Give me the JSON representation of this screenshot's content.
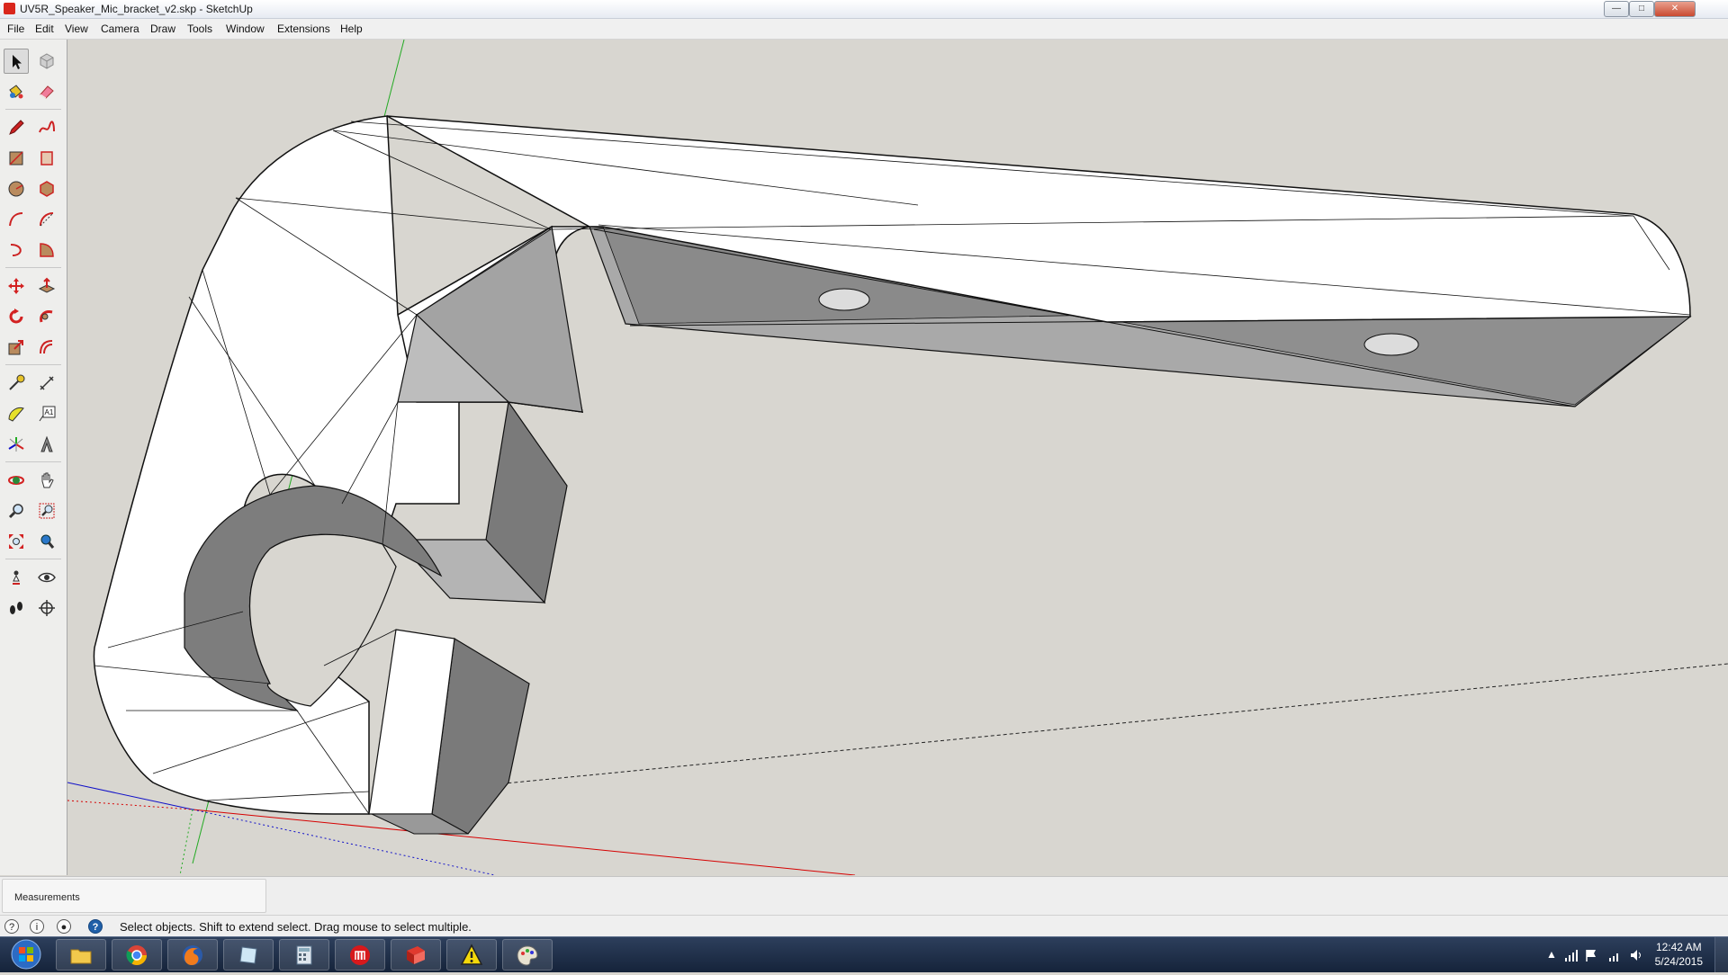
{
  "window": {
    "title": "UV5R_Speaker_Mic_bracket_v2.skp - SketchUp",
    "minimize_label": "—",
    "maximize_label": "□",
    "close_label": "✕"
  },
  "menu": {
    "items": [
      {
        "label": "File"
      },
      {
        "label": "Edit"
      },
      {
        "label": "View"
      },
      {
        "label": "Camera"
      },
      {
        "label": "Draw"
      },
      {
        "label": "Tools"
      },
      {
        "label": "Window"
      },
      {
        "label": "Extensions"
      },
      {
        "label": "Help"
      }
    ]
  },
  "toolbar": {
    "tools": [
      {
        "name": "select-tool",
        "icon": "arrow-icon",
        "active": true
      },
      {
        "name": "component-tool",
        "icon": "component-icon"
      },
      {
        "name": "paint-bucket-tool",
        "icon": "paint-bucket-icon"
      },
      {
        "name": "eraser-tool",
        "icon": "eraser-icon"
      },
      {
        "name": "line-tool",
        "icon": "pencil-icon"
      },
      {
        "name": "freehand-tool",
        "icon": "freehand-icon"
      },
      {
        "name": "rectangle-tool",
        "icon": "rectangle-icon"
      },
      {
        "name": "rotated-rectangle-tool",
        "icon": "rotated-rectangle-icon"
      },
      {
        "name": "circle-tool",
        "icon": "circle-icon"
      },
      {
        "name": "polygon-tool",
        "icon": "polygon-icon"
      },
      {
        "name": "arc-tool",
        "icon": "arc-icon"
      },
      {
        "name": "two-point-arc-tool",
        "icon": "two-point-arc-icon"
      },
      {
        "name": "three-point-arc-tool",
        "icon": "three-point-arc-icon"
      },
      {
        "name": "pie-tool",
        "icon": "pie-icon"
      },
      {
        "name": "move-tool",
        "icon": "move-icon"
      },
      {
        "name": "push-pull-tool",
        "icon": "push-pull-icon"
      },
      {
        "name": "rotate-tool",
        "icon": "rotate-icon"
      },
      {
        "name": "follow-me-tool",
        "icon": "follow-me-icon"
      },
      {
        "name": "scale-tool",
        "icon": "scale-icon"
      },
      {
        "name": "offset-tool",
        "icon": "offset-icon"
      },
      {
        "name": "tape-measure-tool",
        "icon": "tape-measure-icon"
      },
      {
        "name": "dimension-tool",
        "icon": "dimension-icon"
      },
      {
        "name": "protractor-tool",
        "icon": "protractor-icon"
      },
      {
        "name": "text-tool",
        "icon": "text-icon",
        "label": "A1"
      },
      {
        "name": "axes-tool",
        "icon": "axes-icon"
      },
      {
        "name": "3d-text-tool",
        "icon": "3d-text-icon"
      },
      {
        "name": "orbit-tool",
        "icon": "orbit-icon"
      },
      {
        "name": "pan-tool",
        "icon": "hand-icon"
      },
      {
        "name": "zoom-tool",
        "icon": "magnifier-icon"
      },
      {
        "name": "zoom-window-tool",
        "icon": "zoom-window-icon"
      },
      {
        "name": "zoom-extents-tool",
        "icon": "zoom-extents-icon"
      },
      {
        "name": "previous-view-tool",
        "icon": "previous-view-icon"
      },
      {
        "name": "position-camera-tool",
        "icon": "position-camera-icon"
      },
      {
        "name": "look-around-tool",
        "icon": "eye-icon"
      },
      {
        "name": "walk-tool",
        "icon": "footprints-icon"
      },
      {
        "name": "section-plane-tool",
        "icon": "section-plane-icon"
      }
    ]
  },
  "measurements": {
    "label": "Measurements"
  },
  "status": {
    "text": "Select objects. Shift to extend select. Drag mouse to select multiple."
  },
  "taskbar": {
    "apps": [
      {
        "name": "file-explorer",
        "icon": "folder-icon"
      },
      {
        "name": "chrome",
        "icon": "chrome-icon"
      },
      {
        "name": "firefox",
        "icon": "firefox-icon"
      },
      {
        "name": "notes",
        "icon": "notepad-icon"
      },
      {
        "name": "calculator",
        "icon": "calculator-icon"
      },
      {
        "name": "makerbot",
        "icon": "makerbot-icon"
      },
      {
        "name": "sketchup",
        "icon": "sketchup-icon"
      },
      {
        "name": "warning-app",
        "icon": "warning-icon"
      },
      {
        "name": "paint",
        "icon": "palette-icon"
      }
    ],
    "clock_time": "12:42 AM",
    "clock_date": "5/24/2015"
  },
  "colors": {
    "viewport_bg": "#d8d6d0",
    "face_white": "#ffffff",
    "face_gray": "#a6a6a6",
    "face_dark": "#737373",
    "axis_red": "#d60000",
    "axis_green": "#22aa22",
    "axis_blue": "#1010c8"
  }
}
